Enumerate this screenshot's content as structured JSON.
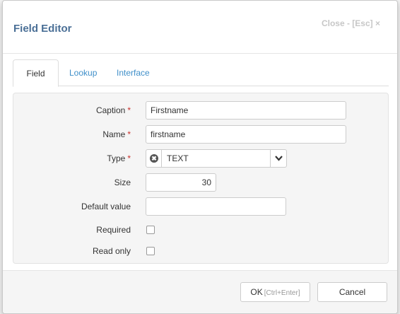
{
  "dialog": {
    "title": "Field Editor",
    "close_label": "Close - [Esc] ×"
  },
  "tabs": [
    {
      "label": "Field",
      "active": true
    },
    {
      "label": "Lookup",
      "active": false
    },
    {
      "label": "Interface",
      "active": false
    }
  ],
  "form": {
    "caption": {
      "label": "Caption",
      "required_mark": "*",
      "value": "Firstname"
    },
    "name": {
      "label": "Name",
      "required_mark": "*",
      "value": "firstname"
    },
    "type": {
      "label": "Type",
      "required_mark": "*",
      "value": "TEXT",
      "icon": "type-circle-icon"
    },
    "size": {
      "label": "Size",
      "value": "30"
    },
    "default_value": {
      "label": "Default value",
      "value": ""
    },
    "required": {
      "label": "Required",
      "checked": false
    },
    "read_only": {
      "label": "Read only",
      "checked": false
    }
  },
  "footer": {
    "ok_label": "OK",
    "ok_hint": "[Ctrl+Enter]",
    "cancel_label": "Cancel"
  },
  "colors": {
    "title": "#4a6f96",
    "tab_link": "#3f8fc9",
    "required_mark": "#c9302c"
  }
}
